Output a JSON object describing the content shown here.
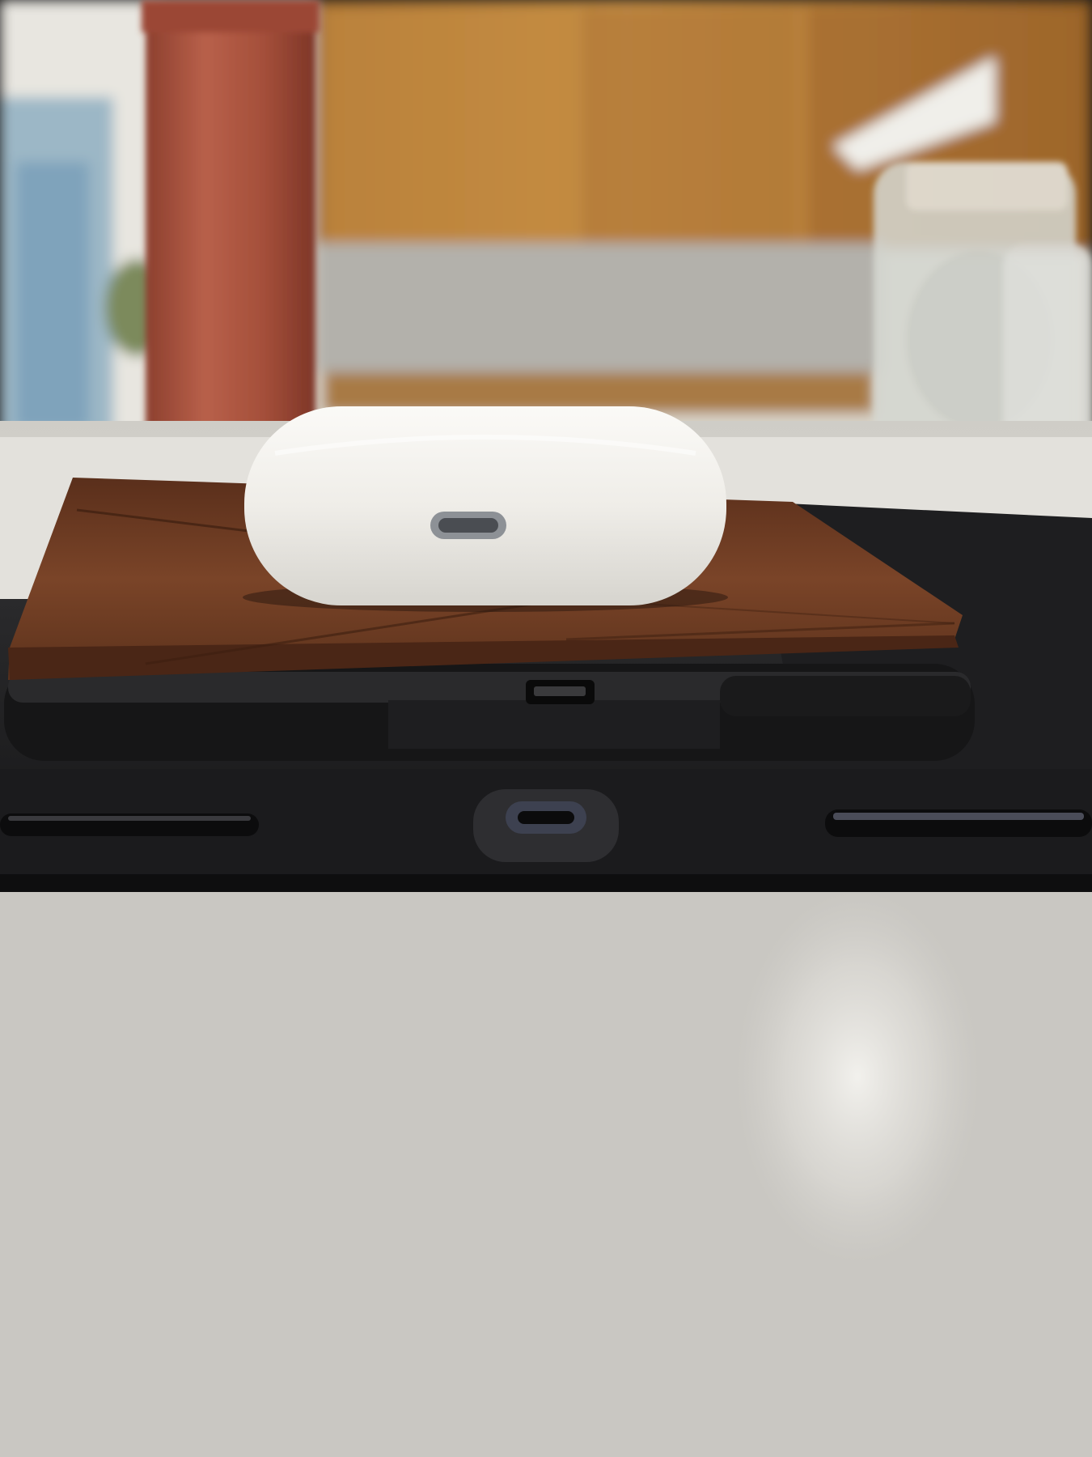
{
  "scene": {
    "description_tag": "photo",
    "colors": {
      "cabinet": "#b8833f",
      "cabinet_dark": "#8a5a25",
      "wall": "#e6e3dc",
      "counter": "#dcdad5",
      "bottle": "#a9543f",
      "leather": "#6b3a22",
      "leather_dark": "#4a2716",
      "tablet_black": "#1c1c1e",
      "case_black": "#202022",
      "airpods_case": "#f2f0eb",
      "port": "#555a63",
      "jar_glass": "#d8dcd8"
    }
  }
}
